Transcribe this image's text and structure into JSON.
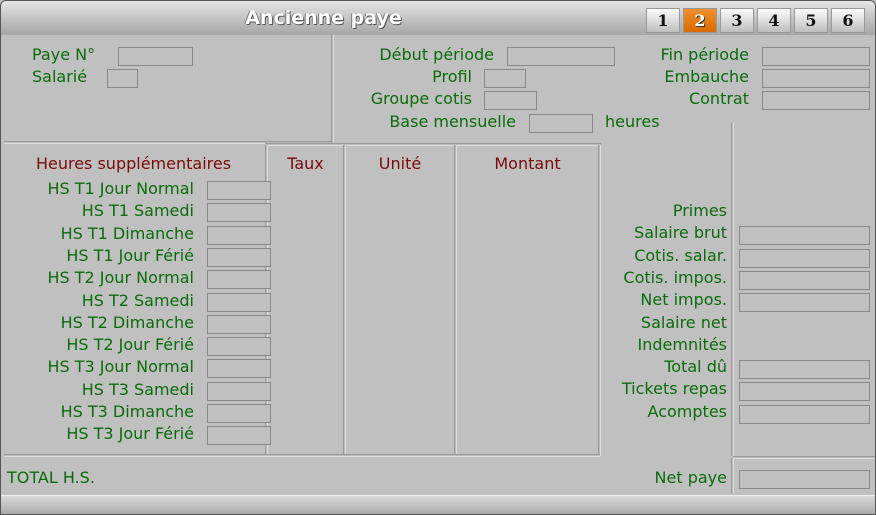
{
  "window": {
    "title": "Ancienne paye"
  },
  "tabs": [
    {
      "label": "1",
      "active": false
    },
    {
      "label": "2",
      "active": true
    },
    {
      "label": "3",
      "active": false
    },
    {
      "label": "4",
      "active": false
    },
    {
      "label": "5",
      "active": false
    },
    {
      "label": "6",
      "active": false
    }
  ],
  "header_fields": {
    "paye_no": {
      "label": "Paye N°",
      "value": ""
    },
    "salarie": {
      "label": "Salarié",
      "value": ""
    },
    "debut_periode": {
      "label": "Début période",
      "value": ""
    },
    "profil": {
      "label": "Profil",
      "value": ""
    },
    "groupe_cotis": {
      "label": "Groupe cotis",
      "value": ""
    },
    "base_mensuelle": {
      "label": "Base mensuelle",
      "value": "",
      "unit": "heures"
    },
    "fin_periode": {
      "label": "Fin période",
      "value": ""
    },
    "embauche": {
      "label": "Embauche",
      "value": ""
    },
    "contrat": {
      "label": "Contrat",
      "value": ""
    }
  },
  "hs_table": {
    "columns": [
      "Heures supplémentaires",
      "Taux",
      "Unité",
      "Montant"
    ],
    "rows": [
      {
        "label": "HS T1 Jour Normal",
        "value": ""
      },
      {
        "label": "HS T1 Samedi",
        "value": ""
      },
      {
        "label": "HS T1 Dimanche",
        "value": ""
      },
      {
        "label": "HS T1 Jour Férié",
        "value": ""
      },
      {
        "label": "HS T2 Jour Normal",
        "value": ""
      },
      {
        "label": "HS T2 Samedi",
        "value": ""
      },
      {
        "label": "HS T2 Dimanche",
        "value": ""
      },
      {
        "label": "HS T2 Jour Férié",
        "value": ""
      },
      {
        "label": "HS T3 Jour Normal",
        "value": ""
      },
      {
        "label": "HS T3 Samedi",
        "value": ""
      },
      {
        "label": "HS T3 Dimanche",
        "value": ""
      },
      {
        "label": "HS T3 Jour Férié",
        "value": ""
      }
    ],
    "total_label": "TOTAL H.S."
  },
  "summary": [
    {
      "label": "Primes",
      "has_field": false,
      "value": ""
    },
    {
      "label": "Salaire brut",
      "has_field": true,
      "value": ""
    },
    {
      "label": "Cotis. salar.",
      "has_field": true,
      "value": ""
    },
    {
      "label": "Cotis. impos.",
      "has_field": true,
      "value": ""
    },
    {
      "label": "Net impos.",
      "has_field": true,
      "value": ""
    },
    {
      "label": "Salaire net",
      "has_field": false,
      "value": ""
    },
    {
      "label": "Indemnités",
      "has_field": false,
      "value": ""
    },
    {
      "label": "Total dû",
      "has_field": true,
      "value": ""
    },
    {
      "label": "Tickets repas",
      "has_field": true,
      "value": ""
    },
    {
      "label": "Acomptes",
      "has_field": true,
      "value": ""
    }
  ],
  "net_paye": {
    "label": "Net paye",
    "value": ""
  }
}
